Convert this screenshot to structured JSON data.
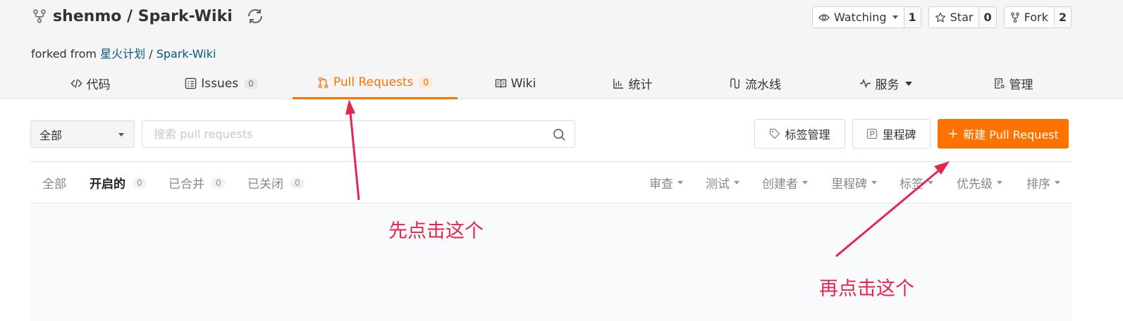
{
  "repo": {
    "title": "shenmo / Spark-Wiki",
    "forked_prefix": "forked from",
    "forked_owner": "星火计划",
    "forked_sep": "/",
    "forked_repo": "Spark-Wiki"
  },
  "actions": {
    "watch_label": "Watching",
    "watch_count": "1",
    "star_label": "Star",
    "star_count": "0",
    "fork_label": "Fork",
    "fork_count": "2"
  },
  "tabs": {
    "code": "代码",
    "issues": "Issues",
    "issues_count": "0",
    "pulls": "Pull Requests",
    "pulls_count": "0",
    "wiki": "Wiki",
    "stats": "统计",
    "pipeline": "流水线",
    "services": "服务",
    "manage": "管理"
  },
  "toolbar": {
    "filter_value": "全部",
    "search_placeholder": "搜索 pull requests",
    "labels_button": "标签管理",
    "milestones_button": "里程碑",
    "new_pr_button": "新建 Pull Request"
  },
  "list": {
    "state_all": "全部",
    "state_open": "开启的",
    "state_open_count": "0",
    "state_merged": "已合并",
    "state_merged_count": "0",
    "state_closed": "已关闭",
    "state_closed_count": "0",
    "sort_review": "审查",
    "sort_test": "测试",
    "sort_author": "创建者",
    "sort_milestone": "里程碑",
    "sort_label": "标签",
    "sort_priority": "优先级",
    "sort_order": "排序"
  },
  "annotations": {
    "first": "先点击这个",
    "second": "再点击这个"
  },
  "colors": {
    "accent": "#fe7300",
    "annotation": "#e5254d",
    "link": "#005980"
  }
}
